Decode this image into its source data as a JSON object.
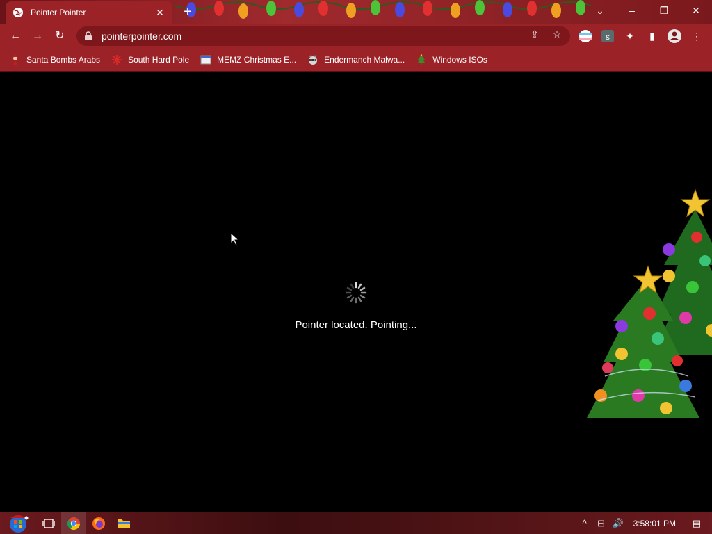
{
  "browser": {
    "tab_title": "Pointer Pointer",
    "tab_close": "✕",
    "new_tab": "+",
    "window_controls": {
      "tab_search": "⌄",
      "minimize": "–",
      "restore": "❐",
      "close": "✕"
    },
    "url": "pointerpointer.com",
    "nav": {
      "back": "←",
      "forward": "→",
      "reload": "↻"
    },
    "toolbar_right": {
      "share": "⇪",
      "bookmark_star": "☆",
      "extensions": "✦",
      "side_panel": "▮",
      "profile": "●",
      "menu": "⋮"
    }
  },
  "bookmarks": [
    {
      "label": "Santa Bombs Arabs",
      "icon": "santa-icon"
    },
    {
      "label": "South Hard Pole",
      "icon": "snowflake-icon"
    },
    {
      "label": "MEMZ Christmas E...",
      "icon": "window-icon"
    },
    {
      "label": "Endermanch Malwa...",
      "icon": "raccoon-icon"
    },
    {
      "label": "Windows ISOs",
      "icon": "tree-icon"
    }
  ],
  "page": {
    "status_text": "Pointer located. Pointing..."
  },
  "taskbar": {
    "clock": "3:58:01 PM",
    "tray": {
      "chevron": "^",
      "network": "⊟",
      "volume": "🔊",
      "notifications": "▤"
    }
  },
  "colors": {
    "chrome_red": "#9b2227",
    "page_bg": "#000000"
  }
}
